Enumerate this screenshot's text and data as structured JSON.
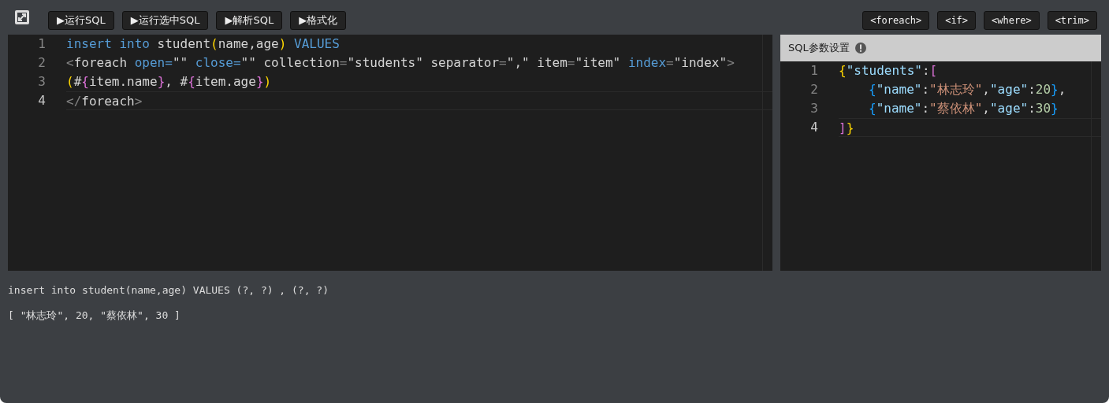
{
  "toolbar": {
    "buttons": [
      "▶运行SQL",
      "▶运行选中SQL",
      "▶解析SQL",
      "▶格式化"
    ],
    "tags": [
      "<foreach>",
      "<if>",
      "<where>",
      "<trim>"
    ]
  },
  "sql_editor": {
    "lines": [
      {
        "number": "1",
        "current": false,
        "tokens": [
          {
            "kind": "keyword",
            "text": "insert into"
          },
          {
            "kind": "plain",
            "text": " student"
          },
          {
            "kind": "paren",
            "text": "("
          },
          {
            "kind": "plain",
            "text": "name,age"
          },
          {
            "kind": "paren",
            "text": ")"
          },
          {
            "kind": "keyword",
            "text": " VALUES"
          }
        ]
      },
      {
        "number": "2",
        "current": false,
        "tokens": [
          {
            "kind": "punct",
            "text": "<"
          },
          {
            "kind": "plain",
            "text": "foreach "
          },
          {
            "kind": "keyword",
            "text": "open="
          },
          {
            "kind": "plain",
            "text": "\"\" "
          },
          {
            "kind": "keyword",
            "text": "close="
          },
          {
            "kind": "plain",
            "text": "\"\" collection"
          },
          {
            "kind": "punct",
            "text": "="
          },
          {
            "kind": "plain",
            "text": "\"students\" separator"
          },
          {
            "kind": "punct",
            "text": "="
          },
          {
            "kind": "plain",
            "text": "\",\" item"
          },
          {
            "kind": "punct",
            "text": "="
          },
          {
            "kind": "plain",
            "text": "\"item\" "
          },
          {
            "kind": "keyword",
            "text": "index"
          },
          {
            "kind": "punct",
            "text": "="
          },
          {
            "kind": "plain",
            "text": "\"index\""
          },
          {
            "kind": "punct",
            "text": ">"
          }
        ]
      },
      {
        "number": "3",
        "current": false,
        "tokens": [
          {
            "kind": "paren",
            "text": "("
          },
          {
            "kind": "plain",
            "text": "#"
          },
          {
            "kind": "brace",
            "text": "{"
          },
          {
            "kind": "plain",
            "text": "item.name"
          },
          {
            "kind": "brace",
            "text": "}"
          },
          {
            "kind": "plain",
            "text": ", #"
          },
          {
            "kind": "brace",
            "text": "{"
          },
          {
            "kind": "plain",
            "text": "item.age"
          },
          {
            "kind": "brace",
            "text": "}"
          },
          {
            "kind": "paren",
            "text": ")"
          }
        ]
      },
      {
        "number": "4",
        "current": true,
        "tokens": [
          {
            "kind": "punct",
            "text": "</"
          },
          {
            "kind": "plain",
            "text": "foreach"
          },
          {
            "kind": "punct",
            "text": ">"
          }
        ]
      }
    ]
  },
  "params_panel": {
    "title": "SQL参数设置",
    "lines": [
      {
        "number": "1",
        "current": false,
        "indented": false,
        "tokens": [
          {
            "kind": "paren",
            "text": "{"
          },
          {
            "kind": "key",
            "text": "\"students\""
          },
          {
            "kind": "plain",
            "text": ":"
          },
          {
            "kind": "brace",
            "text": "["
          }
        ]
      },
      {
        "number": "2",
        "current": false,
        "indented": true,
        "tokens": [
          {
            "kind": "inner",
            "text": "{"
          },
          {
            "kind": "key",
            "text": "\"name\""
          },
          {
            "kind": "plain",
            "text": ":"
          },
          {
            "kind": "string",
            "text": "\"林志玲\""
          },
          {
            "kind": "plain",
            "text": ","
          },
          {
            "kind": "key",
            "text": "\"age\""
          },
          {
            "kind": "plain",
            "text": ":"
          },
          {
            "kind": "number",
            "text": "20"
          },
          {
            "kind": "inner",
            "text": "}"
          },
          {
            "kind": "plain",
            "text": ","
          }
        ]
      },
      {
        "number": "3",
        "current": false,
        "indented": true,
        "tokens": [
          {
            "kind": "inner",
            "text": "{"
          },
          {
            "kind": "key",
            "text": "\"name\""
          },
          {
            "kind": "plain",
            "text": ":"
          },
          {
            "kind": "string",
            "text": "\"蔡依林\""
          },
          {
            "kind": "plain",
            "text": ","
          },
          {
            "kind": "key",
            "text": "\"age\""
          },
          {
            "kind": "plain",
            "text": ":"
          },
          {
            "kind": "number",
            "text": "30"
          },
          {
            "kind": "inner",
            "text": "}"
          }
        ]
      },
      {
        "number": "4",
        "current": true,
        "indented": false,
        "tokens": [
          {
            "kind": "brace",
            "text": "]"
          },
          {
            "kind": "paren",
            "text": "}"
          }
        ]
      }
    ]
  },
  "output": {
    "sql": "insert into student(name,age) VALUES (?, ?) , (?, ?)",
    "params": "[ \"林志玲\", 20, \"蔡依林\", 30 ]"
  }
}
